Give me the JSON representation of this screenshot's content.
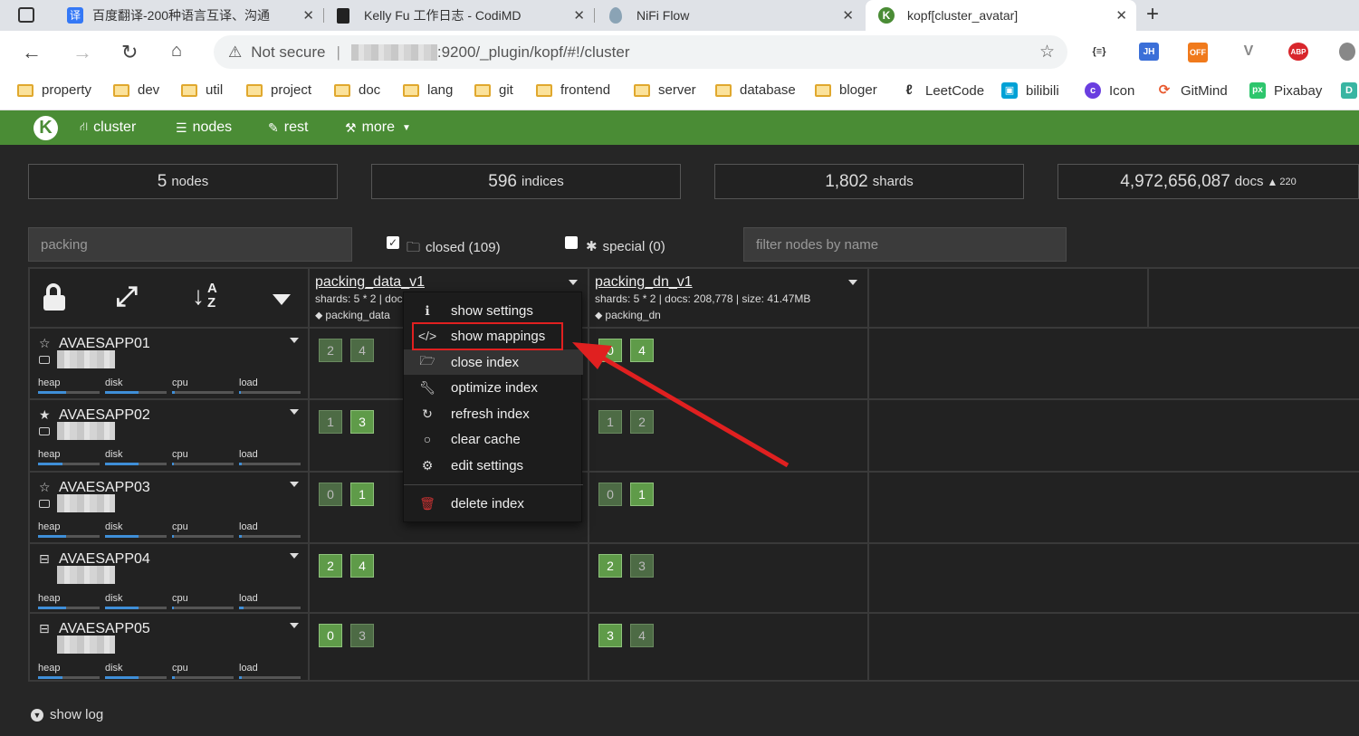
{
  "browser": {
    "tabs": [
      {
        "label": "百度翻译-200种语言互译、沟通"
      },
      {
        "label": "Kelly Fu 工作日志 - CodiMD"
      },
      {
        "label": "NiFi Flow"
      },
      {
        "label": "kopf[cluster_avatar]"
      }
    ],
    "url_security": "Not secure",
    "url": ":9200/_plugin/kopf/#!/cluster",
    "ext_labels": [
      "{≡}",
      "JH",
      "OFF",
      "V",
      "ABP"
    ],
    "bookmarks": [
      "property",
      "dev",
      "util",
      "project",
      "doc",
      "lang",
      "git",
      "frontend",
      "server",
      "database",
      "bloger"
    ],
    "bookmark_links": [
      "LeetCode",
      "bilibili",
      "Icon",
      "GitMind",
      "Pixabay"
    ]
  },
  "app": {
    "nav": [
      "cluster",
      "nodes",
      "rest",
      "more"
    ],
    "stats": [
      {
        "value": "5",
        "unit": "nodes"
      },
      {
        "value": "596",
        "unit": "indices"
      },
      {
        "value": "1,802",
        "unit": "shards"
      },
      {
        "value": "4,972,656,087",
        "unit": "docs",
        "delta": "220"
      }
    ],
    "filter_indices_value": "packing",
    "closed_label": "closed (109)",
    "special_label": "special (0)",
    "filter_nodes_placeholder": "filter nodes by name",
    "indices": [
      {
        "name": "packing_data_v1",
        "meta": "shards: 5 * 2 | doc",
        "tag": "packing_data"
      },
      {
        "name": "packing_dn_v1",
        "meta": "shards: 5 * 2 | docs: 208,778 | size: 41.47MB",
        "tag": "packing_dn"
      }
    ],
    "metric_labels": [
      "heap",
      "disk",
      "cpu",
      "load"
    ],
    "nodes": [
      {
        "name": "AVAESAPP01",
        "master": false,
        "heap": 0.45,
        "disk": 0.55,
        "cpu": 0.04,
        "load": 0.03
      },
      {
        "name": "AVAESAPP02",
        "master": true,
        "heap": 0.4,
        "disk": 0.55,
        "cpu": 0.03,
        "load": 0.05
      },
      {
        "name": "AVAESAPP03",
        "master": false,
        "heap": 0.45,
        "disk": 0.55,
        "cpu": 0.03,
        "load": 0.04
      },
      {
        "name": "AVAESAPP04",
        "master": false,
        "heap": 0.45,
        "disk": 0.55,
        "cpu": 0.03,
        "load": 0.07
      },
      {
        "name": "AVAESAPP05",
        "master": false,
        "heap": 0.4,
        "disk": 0.55,
        "cpu": 0.04,
        "load": 0.05
      }
    ],
    "shards": [
      [
        [
          "2",
          "4"
        ],
        [
          "0",
          "4"
        ]
      ],
      [
        [
          "1",
          "3"
        ],
        [
          "1",
          "2"
        ]
      ],
      [
        [
          "0",
          "1"
        ],
        [
          "0",
          "1"
        ]
      ],
      [
        [
          "2",
          "4"
        ],
        [
          "2",
          "3"
        ]
      ],
      [
        [
          "0",
          "3"
        ],
        [
          "3",
          "4"
        ]
      ]
    ],
    "context_menu": [
      "show settings",
      "show mappings",
      "close index",
      "optimize index",
      "refresh index",
      "clear cache",
      "edit settings",
      "delete index"
    ],
    "show_log": "show log"
  },
  "colors": {
    "navbar": "#4a8c35",
    "shard_primary": "#5f9b49",
    "shard_replica": "#4d6b45",
    "highlight": "#e02020",
    "bar": "#3f8fd8"
  }
}
